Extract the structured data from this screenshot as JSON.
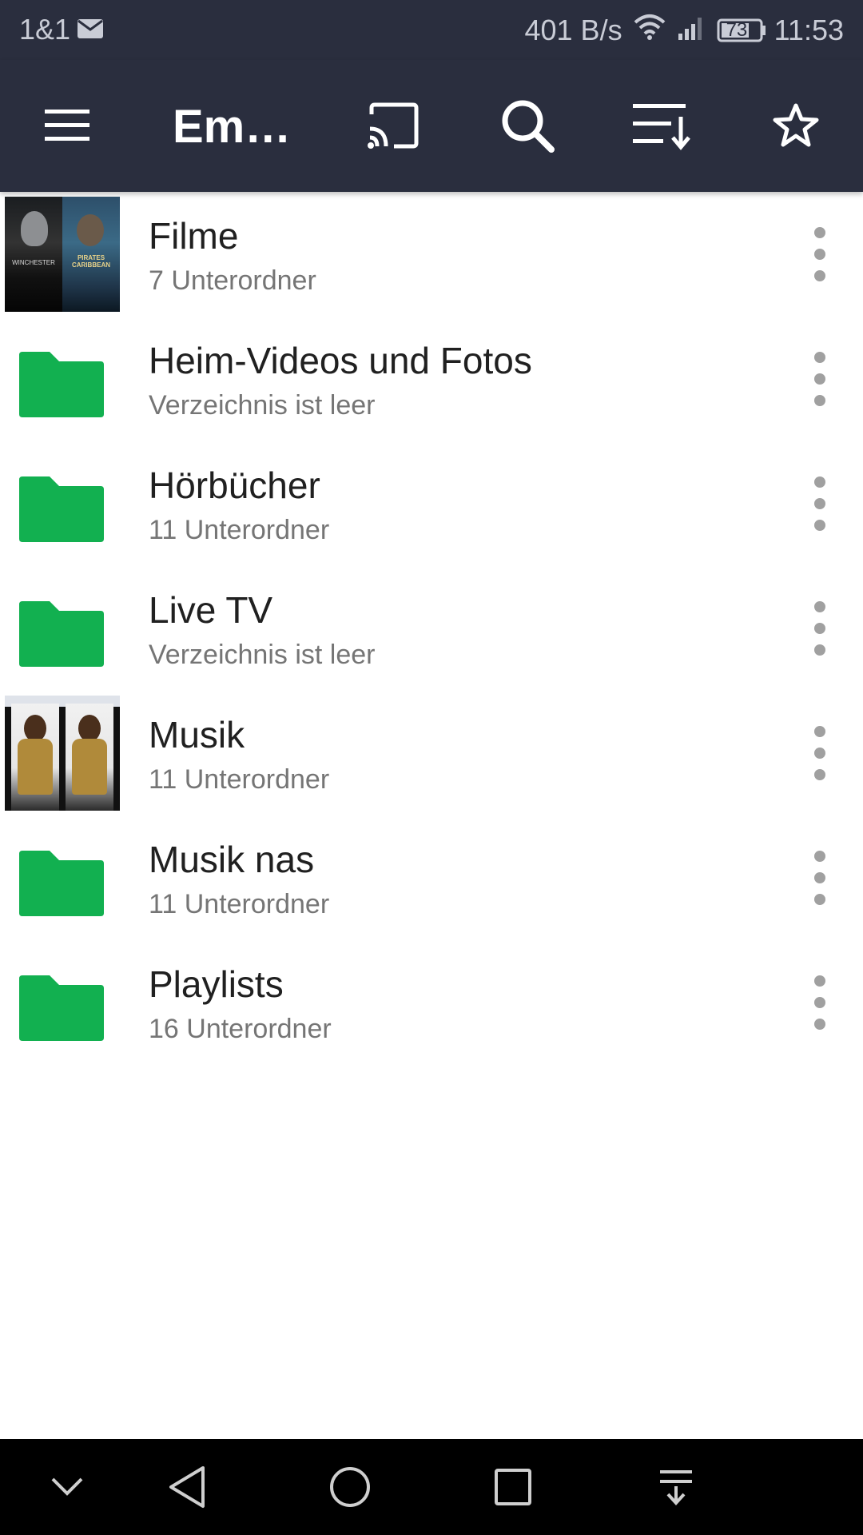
{
  "status_bar": {
    "carrier": "1&1",
    "speed": "401 B/s",
    "battery": "73",
    "time": "11:53"
  },
  "toolbar": {
    "title": "Em…",
    "icons": [
      "menu-icon",
      "cast-icon",
      "search-icon",
      "sort-icon",
      "star-icon"
    ]
  },
  "items": [
    {
      "title": "Filme",
      "subtitle": "7 Unterordner",
      "thumb": "poster",
      "thumb_labels": [
        "WINCHESTER",
        "PIRATES CARIBBEAN"
      ]
    },
    {
      "title": "Heim-Videos und Fotos",
      "subtitle": "Verzeichnis ist leer",
      "thumb": "folder"
    },
    {
      "title": "Hörbücher",
      "subtitle": "11 Unterordner",
      "thumb": "folder"
    },
    {
      "title": "Live TV",
      "subtitle": "Verzeichnis ist leer",
      "thumb": "folder"
    },
    {
      "title": "Musik",
      "subtitle": "11 Unterordner",
      "thumb": "album"
    },
    {
      "title": "Musik nas",
      "subtitle": "11 Unterordner",
      "thumb": "folder"
    },
    {
      "title": "Playlists",
      "subtitle": "16 Unterordner",
      "thumb": "folder"
    }
  ],
  "colors": {
    "bar_bg": "#2a2e3e",
    "folder_green": "#12b050"
  },
  "navigation_bar": [
    "collapse-icon",
    "back-icon",
    "home-icon",
    "recents-icon",
    "notification-pull-icon"
  ]
}
